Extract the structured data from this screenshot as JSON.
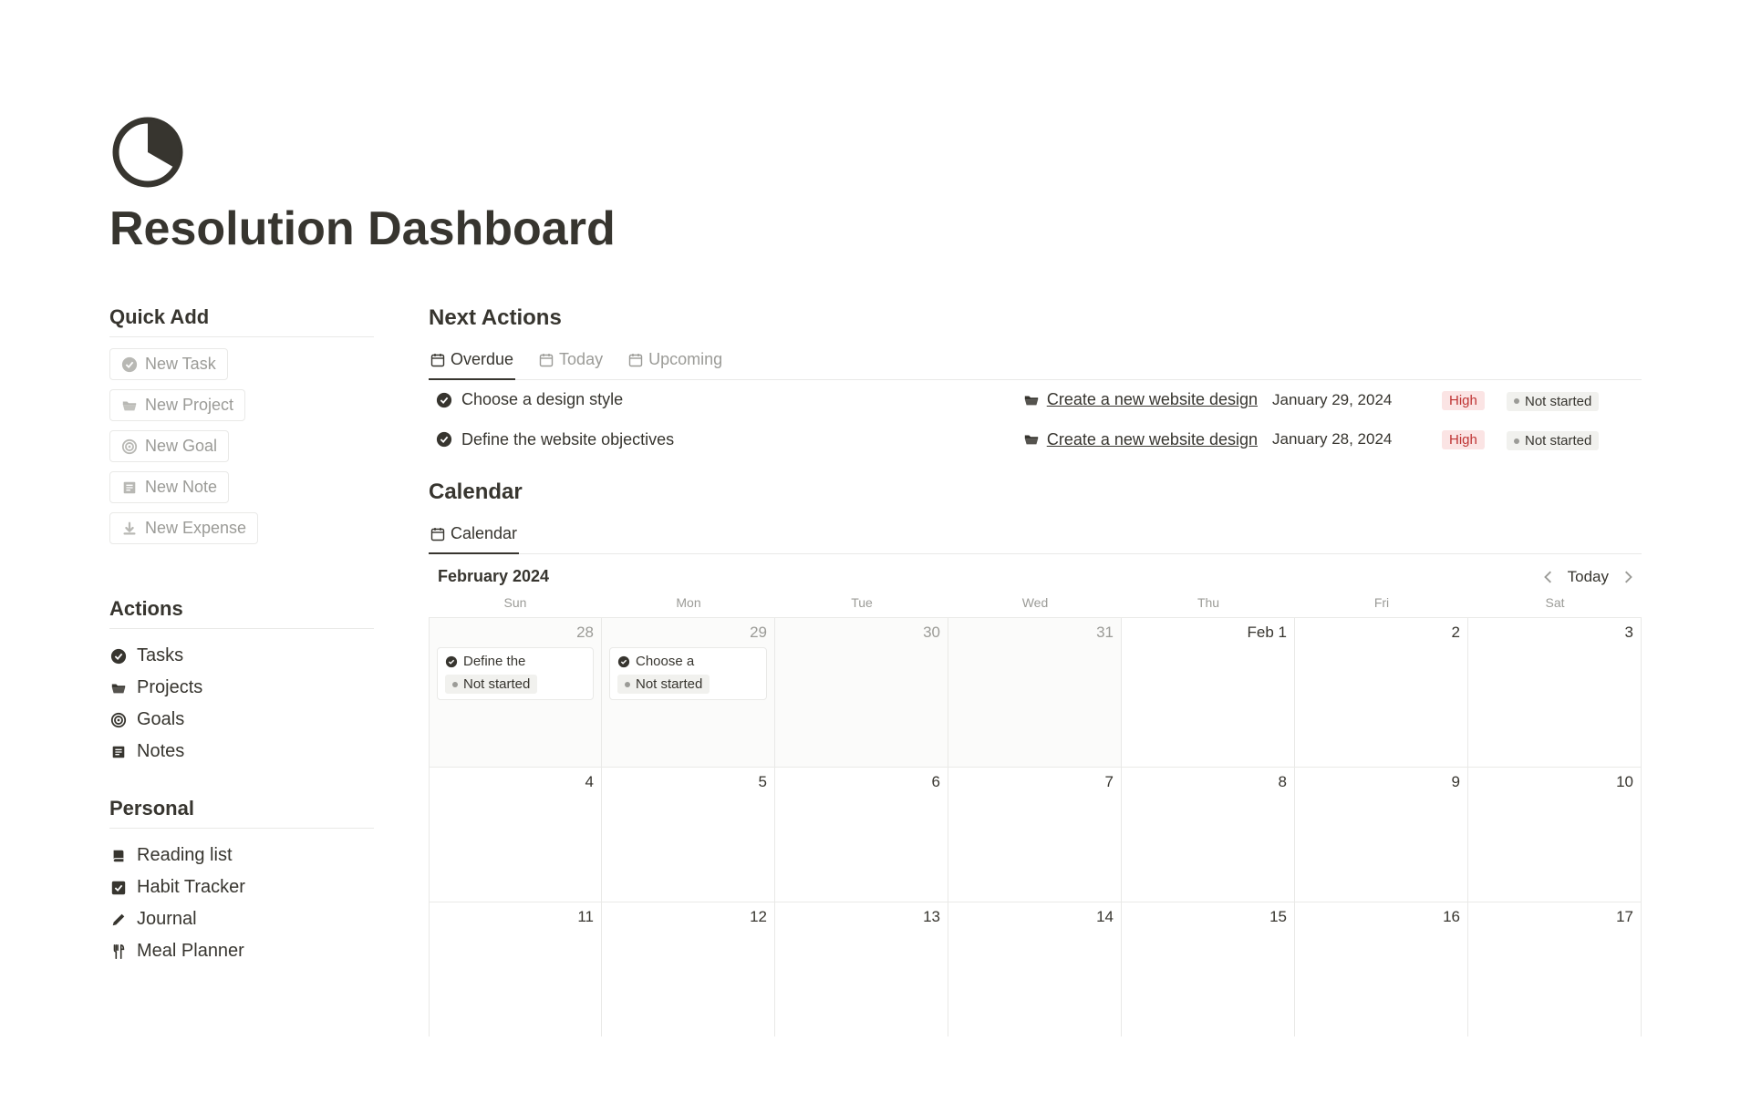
{
  "page": {
    "title": "Resolution Dashboard"
  },
  "quick_add": {
    "heading": "Quick Add",
    "buttons": [
      {
        "label": "New Task",
        "icon": "check-circle-icon"
      },
      {
        "label": "New Project",
        "icon": "folder-open-icon"
      },
      {
        "label": "New Goal",
        "icon": "target-icon"
      },
      {
        "label": "New Note",
        "icon": "note-icon"
      },
      {
        "label": "New Expense",
        "icon": "download-arrow-icon"
      }
    ]
  },
  "actions": {
    "heading": "Actions",
    "items": [
      {
        "label": "Tasks",
        "icon": "check-circle-icon"
      },
      {
        "label": "Projects",
        "icon": "folder-open-icon"
      },
      {
        "label": "Goals",
        "icon": "target-icon"
      },
      {
        "label": "Notes",
        "icon": "note-icon"
      }
    ]
  },
  "personal": {
    "heading": "Personal",
    "items": [
      {
        "label": "Reading list",
        "icon": "book-icon"
      },
      {
        "label": "Habit Tracker",
        "icon": "checkbox-icon"
      },
      {
        "label": "Journal",
        "icon": "pencil-icon"
      },
      {
        "label": "Meal Planner",
        "icon": "utensils-icon"
      }
    ]
  },
  "next_actions": {
    "heading": "Next Actions",
    "tabs": [
      {
        "label": "Overdue",
        "active": true
      },
      {
        "label": "Today",
        "active": false
      },
      {
        "label": "Upcoming",
        "active": false
      }
    ],
    "rows": [
      {
        "title": "Choose a design style",
        "project": "Create a new website design",
        "date": "January 29, 2024",
        "priority": "High",
        "status": "Not started"
      },
      {
        "title": "Define the website objectives",
        "project": "Create a new website design",
        "date": "January 28, 2024",
        "priority": "High",
        "status": "Not started"
      }
    ]
  },
  "calendar": {
    "heading": "Calendar",
    "tab": "Calendar",
    "month": "February 2024",
    "today_label": "Today",
    "daylabels": [
      "Sun",
      "Mon",
      "Tue",
      "Wed",
      "Thu",
      "Fri",
      "Sat"
    ],
    "weeks": [
      [
        {
          "label": "28",
          "outside": true,
          "event": {
            "title": "Define the",
            "status": "Not started"
          }
        },
        {
          "label": "29",
          "outside": true,
          "event": {
            "title": "Choose a",
            "status": "Not started"
          }
        },
        {
          "label": "30",
          "outside": true
        },
        {
          "label": "31",
          "outside": true
        },
        {
          "label": "Feb 1"
        },
        {
          "label": "2"
        },
        {
          "label": "3"
        }
      ],
      [
        {
          "label": "4"
        },
        {
          "label": "5"
        },
        {
          "label": "6"
        },
        {
          "label": "7"
        },
        {
          "label": "8"
        },
        {
          "label": "9"
        },
        {
          "label": "10"
        }
      ],
      [
        {
          "label": "11"
        },
        {
          "label": "12"
        },
        {
          "label": "13"
        },
        {
          "label": "14"
        },
        {
          "label": "15"
        },
        {
          "label": "16"
        },
        {
          "label": "17"
        }
      ]
    ]
  }
}
